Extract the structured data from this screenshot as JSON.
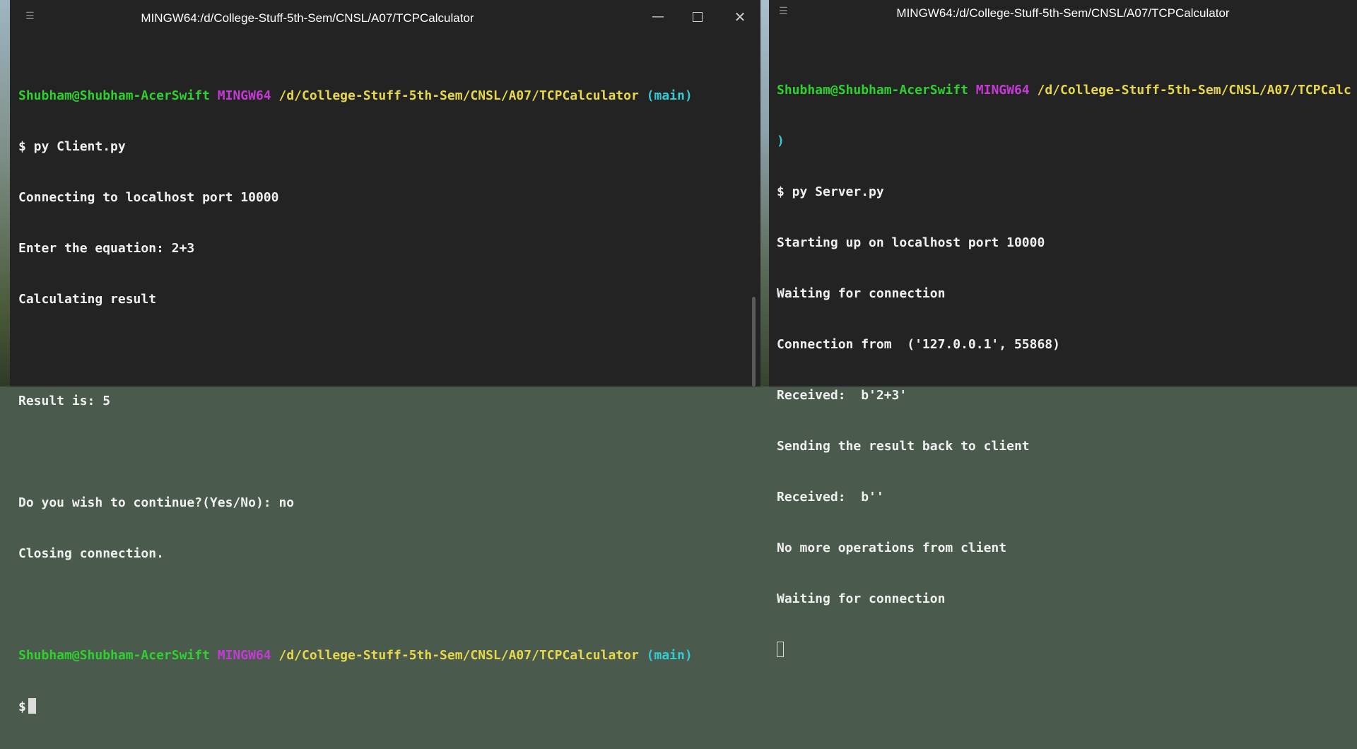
{
  "left_window": {
    "title": "MINGW64:/d/College-Stuff-5th-Sem/CNSL/A07/TCPCalculator",
    "prompt1": {
      "user": "Shubham@Shubham-AcerSwift",
      "env": "MINGW64",
      "path": "/d/College-Stuff-5th-Sem/CNSL/A07/TCPCalculator",
      "branch": "(main)"
    },
    "lines": [
      "$ py Client.py",
      "Connecting to localhost port 10000",
      "Enter the equation: 2+3",
      "Calculating result",
      "",
      "Result is: 5",
      "",
      "Do you wish to continue?(Yes/No): no",
      "Closing connection.",
      ""
    ],
    "prompt2": {
      "user": "Shubham@Shubham-AcerSwift",
      "env": "MINGW64",
      "path": "/d/College-Stuff-5th-Sem/CNSL/A07/TCPCalculator",
      "branch": "(main)"
    },
    "final_prompt": "$"
  },
  "right_window": {
    "title": "MINGW64:/d/College-Stuff-5th-Sem/CNSL/A07/TCPCalculator",
    "prompt": {
      "user": "Shubham@Shubham-AcerSwift",
      "env": "MINGW64",
      "path": "/d/College-Stuff-5th-Sem/CNSL/A07/TCPCalc",
      "wrap": ")"
    },
    "lines": [
      "$ py Server.py",
      "Starting up on localhost port 10000",
      "Waiting for connection",
      "Connection from  ('127.0.0.1', 55868)",
      "Received:  b'2+3'",
      "Sending the result back to client",
      "Received:  b''",
      "No more operations from client",
      "Waiting for connection"
    ]
  },
  "icons": {
    "menu": "☰",
    "minimize": "—",
    "close": "✕"
  }
}
